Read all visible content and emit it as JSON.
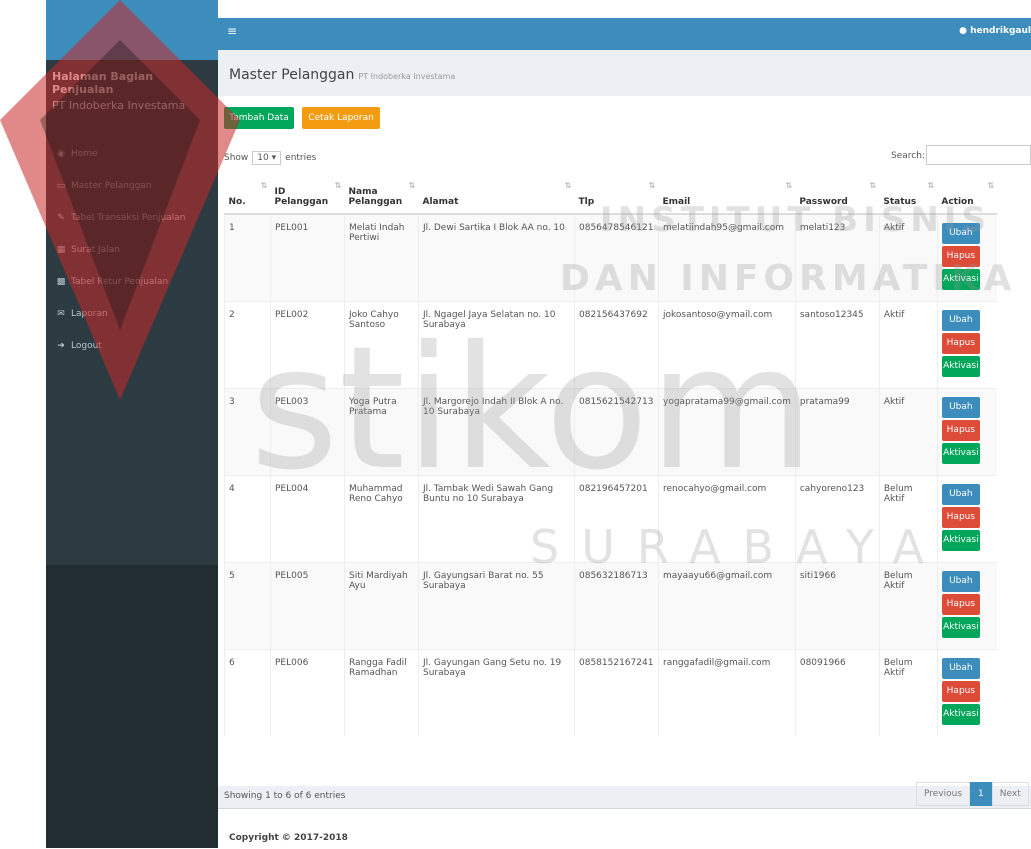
{
  "user": {
    "name": "hendrikgaul"
  },
  "sidebar": {
    "brand_title": "Halaman Bagian Penjualan",
    "brand_subtitle": "PT Indoberka Investama",
    "items": [
      {
        "label": "Home",
        "icon": "dashboard-icon"
      },
      {
        "label": "Master Pelanggan",
        "icon": "laptop-icon"
      },
      {
        "label": "Tabel Transaksi Penjualan",
        "icon": "edit-icon"
      },
      {
        "label": "Surat Jalan",
        "icon": "table-icon"
      },
      {
        "label": "Tabel Retur Penjualan",
        "icon": "calendar-icon"
      },
      {
        "label": "Laporan",
        "icon": "envelope-icon"
      },
      {
        "label": "Logout",
        "icon": "sign-out-icon"
      }
    ]
  },
  "page": {
    "title": "Master Pelanggan",
    "subtitle": "PT Indoberka Investama"
  },
  "toolbar": {
    "add_label": "Tambah Data",
    "print_label": "Cetak Laporan"
  },
  "table_controls": {
    "show_label": "Show",
    "entries_value": "10",
    "entries_label": "entries",
    "search_label": "Search:"
  },
  "columns": [
    "No.",
    "ID Pelanggan",
    "Nama Pelanggan",
    "Alamat",
    "Tlp",
    "Email",
    "Password",
    "Status",
    "Action"
  ],
  "rows": [
    {
      "no": "1",
      "id": "PEL001",
      "nama": "Melati Indah Pertiwi",
      "alamat": "Jl. Dewi Sartika I Blok AA no. 10",
      "tlp": "0856478546121",
      "email": "melatiindah95@gmail.com",
      "password": "melati123",
      "status": "Aktif"
    },
    {
      "no": "2",
      "id": "PEL002",
      "nama": "Joko Cahyo Santoso",
      "alamat": "Jl. Ngagel Jaya Selatan no. 10 Surabaya",
      "tlp": "082156437692",
      "email": "jokosantoso@ymail.com",
      "password": "santoso12345",
      "status": "Aktif"
    },
    {
      "no": "3",
      "id": "PEL003",
      "nama": "Yoga Putra Pratama",
      "alamat": "Jl. Margorejo Indah II Blok A no. 10 Surabaya",
      "tlp": "0815621542713",
      "email": "yogapratama99@gmail.com",
      "password": "pratama99",
      "status": "Aktif"
    },
    {
      "no": "4",
      "id": "PEL004",
      "nama": "Muhammad Reno Cahyo",
      "alamat": "Jl. Tambak Wedi Sawah Gang Buntu no 10 Surabaya",
      "tlp": "082196457201",
      "email": "renocahyo@gmail.com",
      "password": "cahyoreno123",
      "status": "Belum Aktif"
    },
    {
      "no": "5",
      "id": "PEL005",
      "nama": "Siti Mardiyah Ayu",
      "alamat": "Jl. Gayungsari Barat no. 55 Surabaya",
      "tlp": "085632186713",
      "email": "mayaayu66@gmail.com",
      "password": "siti1966",
      "status": "Belum Aktif"
    },
    {
      "no": "6",
      "id": "PEL006",
      "nama": "Rangga Fadil Ramadhan",
      "alamat": "Jl. Gayungan Gang Setu no. 19 Surabaya",
      "tlp": "0858152167241",
      "email": "ranggafadil@gmail.com",
      "password": "08091966",
      "status": "Belum Aktif"
    }
  ],
  "actions": {
    "edit": "Ubah",
    "delete": "Hapus",
    "activate": "Aktivasi"
  },
  "info": "Showing 1 to 6 of 6 entries",
  "pagination": {
    "previous": "Previous",
    "current": "1",
    "next": "Next"
  },
  "footer": {
    "copyright": "Copyright © 2017-2018"
  },
  "watermark": {
    "line1": "INSTITUT BISNIS",
    "line2": "DAN INFORMATIKA",
    "logo": "stikom",
    "city": "SURABAYA"
  }
}
